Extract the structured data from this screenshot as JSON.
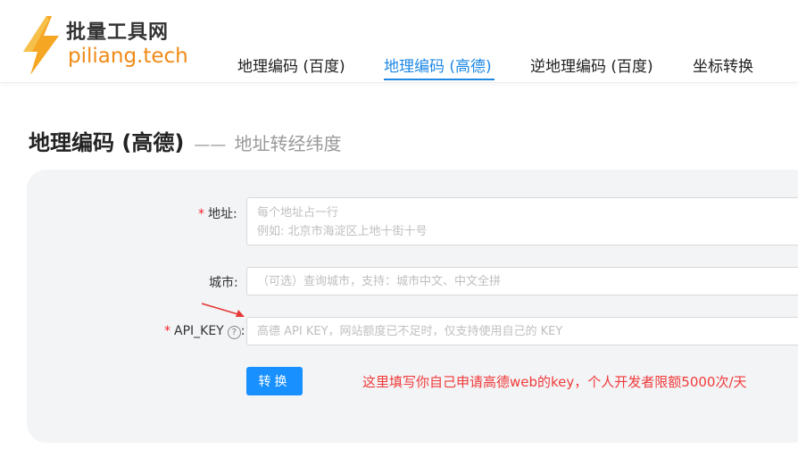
{
  "logo": {
    "cn": "批量工具网",
    "en": "piliang.tech",
    "icon": "lightning-bolt-icon",
    "bolt_color": "#f5a623",
    "en_color": "#f08a16"
  },
  "nav": {
    "items": [
      {
        "label": "地理编码 (百度)"
      },
      {
        "label": "地理编码 (高德)",
        "active": true
      },
      {
        "label": "逆地理编码 (百度)"
      },
      {
        "label": "坐标转换"
      }
    ],
    "accent": "#1e88e5"
  },
  "page": {
    "title": "地理编码 (高德)",
    "separator": "——",
    "subtitle": "地址转经纬度"
  },
  "form": {
    "address": {
      "required_mark": "*",
      "label": "地址:",
      "placeholder": "每个地址占一行\n例如: 北京市海淀区上地十街十号",
      "value": ""
    },
    "city": {
      "label": "城市:",
      "placeholder": "（可选）查询城市，支持：城市中文、中文全拼",
      "value": ""
    },
    "api_key": {
      "required_mark": "*",
      "label": "API_KEY",
      "help_icon": "question-circle-icon",
      "help_glyph": "?",
      "label_suffix": ":",
      "placeholder": "高德 API KEY，网站额度已不足时，仅支持使用自己的 KEY",
      "value": ""
    },
    "convert_label": "转换"
  },
  "annotation": {
    "arrow_icon": "red-arrow-icon",
    "note": "这里填写你自己申请高德web的key，个人开发者限额5000次/天",
    "color": "#f03a3a"
  }
}
